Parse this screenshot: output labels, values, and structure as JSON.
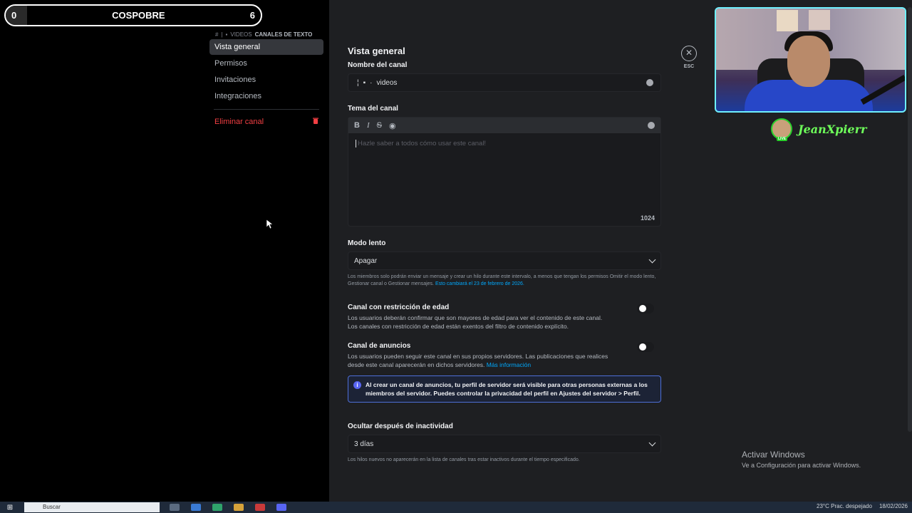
{
  "scoreboard": {
    "left": "0",
    "title": "COSPOBRE",
    "right": "6"
  },
  "sidebar": {
    "breadcrumb_hash": "#",
    "breadcrumb_channel": "VIDEOS",
    "breadcrumb_category": "CANALES DE TEXTO",
    "items": [
      {
        "label": "Vista general",
        "active": true
      },
      {
        "label": "Permisos"
      },
      {
        "label": "Invitaciones"
      },
      {
        "label": "Integraciones"
      }
    ],
    "delete_label": "Eliminar canal"
  },
  "main": {
    "title": "Vista general",
    "channel_name_label": "Nombre del canal",
    "channel_name_value": "videos",
    "topic_label": "Tema del canal",
    "topic_placeholder": "Hazle saber a todos cómo usar este canal!",
    "topic_counter": "1024",
    "toolbar": {
      "bold": "B",
      "italic": "I",
      "strike": "S"
    },
    "slowmode_label": "Modo lento",
    "slowmode_value": "Apagar",
    "slowmode_help": "Los miembros solo podrán enviar un mensaje y crear un hilo durante este intervalo, a menos que tengan los permisos Omitir el modo lento, Gestionar canal o Gestionar mensajes.",
    "slowmode_help_link": "Esto cambiará el 23 de febrero de 2026.",
    "age_label": "Canal con restricción de edad",
    "age_desc_1": "Los usuarios deberán confirmar que son mayores de edad para ver el contenido de este canal.",
    "age_desc_2": "Los canales con restricción de edad están exentos del filtro de contenido explícito.",
    "announce_label": "Canal de anuncios",
    "announce_desc": "Los usuarios pueden seguir este canal en sus propios servidores. Las publicaciones que realices desde este canal aparecerán en dichos servidores.",
    "announce_link": "Más información",
    "info_text": "Al crear un canal de anuncios, tu perfil de servidor será visible para otras personas externas a los miembros del servidor. Puedes controlar la privacidad del perfil en Ajustes del servidor > Perfil.",
    "inactivity_label": "Ocultar después de inactividad",
    "inactivity_value": "3 días",
    "inactivity_help": "Los hilos nuevos no aparecerán en la lista de canales tras estar inactivos durante el tiempo especificado.",
    "close_label": "ESC"
  },
  "stream": {
    "name": "JeanXpierr",
    "live": "LIVE"
  },
  "windows": {
    "activate_title": "Activar Windows",
    "activate_sub": "Ve a Configuración para activar Windows.",
    "search": "Buscar",
    "weather": "23°C  Prac. despejado",
    "date": "18/02/2026"
  },
  "colors": {
    "accent": "#5865f2",
    "danger": "#f23f43",
    "link": "#00a8fc",
    "panel": "#1e1f22"
  }
}
